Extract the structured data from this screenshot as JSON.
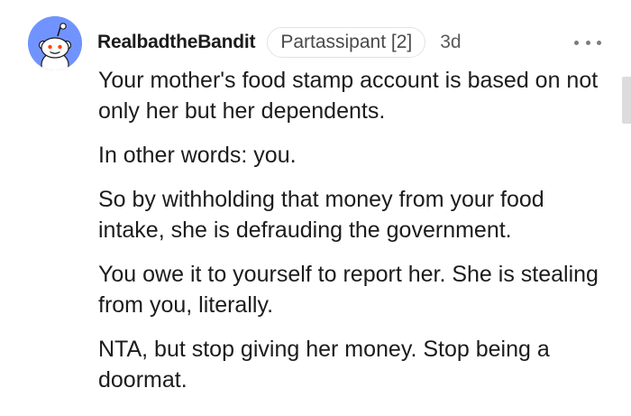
{
  "comment": {
    "username": "RealbadtheBandit",
    "flair": "Partassipant [2]",
    "timestamp": "3d",
    "paragraphs": [
      "Your mother's food stamp account is based on not only her but her dependents.",
      "In other words: you.",
      "So by withholding that money from your food intake, she is defrauding the government.",
      "You owe it to yourself to report her. She is stealing from you, literally.",
      "NTA, but stop giving her money. Stop being a doormat."
    ]
  },
  "icons": {
    "avatar": "snoo-avatar-icon",
    "more": "more-options-icon"
  },
  "colors": {
    "avatar_background": "#7193ff",
    "text": "#1c1c1c",
    "flair_border": "#e3e3e3"
  }
}
